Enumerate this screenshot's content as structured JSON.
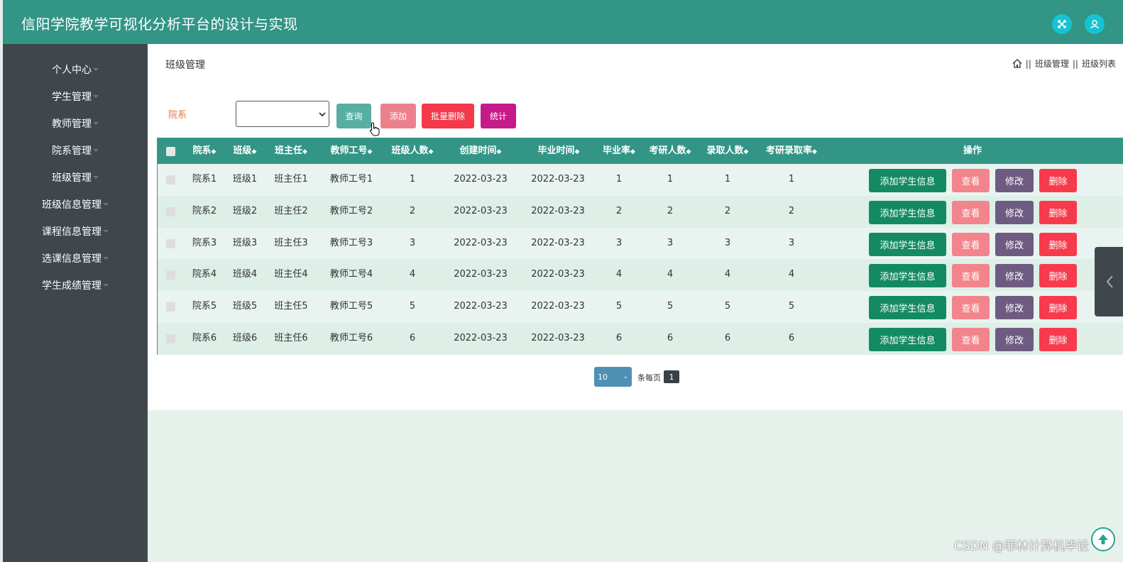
{
  "header": {
    "title": "信阳学院教学可视化分析平台的设计与实现",
    "accent_color": "#329585",
    "icons": [
      "fullscreen-icon",
      "user-icon"
    ]
  },
  "sidebar": {
    "items": [
      {
        "label": "个人中心"
      },
      {
        "label": "学生管理"
      },
      {
        "label": "教师管理"
      },
      {
        "label": "院系管理"
      },
      {
        "label": "班级管理"
      },
      {
        "label": "班级信息管理"
      },
      {
        "label": "课程信息管理"
      },
      {
        "label": "选课信息管理"
      },
      {
        "label": "学生成绩管理"
      }
    ]
  },
  "page": {
    "title": "班级管理",
    "breadcrumb": [
      "班级管理",
      "班级列表"
    ],
    "breadcrumb_separator": "||"
  },
  "filter": {
    "label": "院系",
    "selected": "",
    "buttons": {
      "query": "查询",
      "add": "添加",
      "batch_delete": "批量删除",
      "stats": "统计"
    }
  },
  "table": {
    "columns": [
      "院系",
      "班级",
      "班主任",
      "教师工号",
      "班级人数",
      "创建时间",
      "毕业时间",
      "毕业率",
      "考研人数",
      "录取人数",
      "考研录取率",
      "操作"
    ],
    "sort_glyph": "◆",
    "actions": {
      "add_student": "添加学生信息",
      "view": "查看",
      "edit": "修改",
      "delete": "删除"
    },
    "rows": [
      [
        "院系1",
        "班级1",
        "班主任1",
        "教师工号1",
        "1",
        "2022-03-23",
        "2022-03-23",
        "1",
        "1",
        "1",
        "1"
      ],
      [
        "院系2",
        "班级2",
        "班主任2",
        "教师工号2",
        "2",
        "2022-03-23",
        "2022-03-23",
        "2",
        "2",
        "2",
        "2"
      ],
      [
        "院系3",
        "班级3",
        "班主任3",
        "教师工号3",
        "3",
        "2022-03-23",
        "2022-03-23",
        "3",
        "3",
        "3",
        "3"
      ],
      [
        "院系4",
        "班级4",
        "班主任4",
        "教师工号4",
        "4",
        "2022-03-23",
        "2022-03-23",
        "4",
        "4",
        "4",
        "4"
      ],
      [
        "院系5",
        "班级5",
        "班主任5",
        "教师工号5",
        "5",
        "2022-03-23",
        "2022-03-23",
        "5",
        "5",
        "5",
        "5"
      ],
      [
        "院系6",
        "班级6",
        "班主任6",
        "教师工号6",
        "6",
        "2022-03-23",
        "2022-03-23",
        "6",
        "6",
        "6",
        "6"
      ]
    ],
    "row_colors": [
      "#e9f4f0",
      "#ddefe7"
    ]
  },
  "pagination": {
    "page_size": "10",
    "per_page_label": "条每页",
    "current_page": "1"
  },
  "watermark": "CSDN @菲林计算机毕设"
}
